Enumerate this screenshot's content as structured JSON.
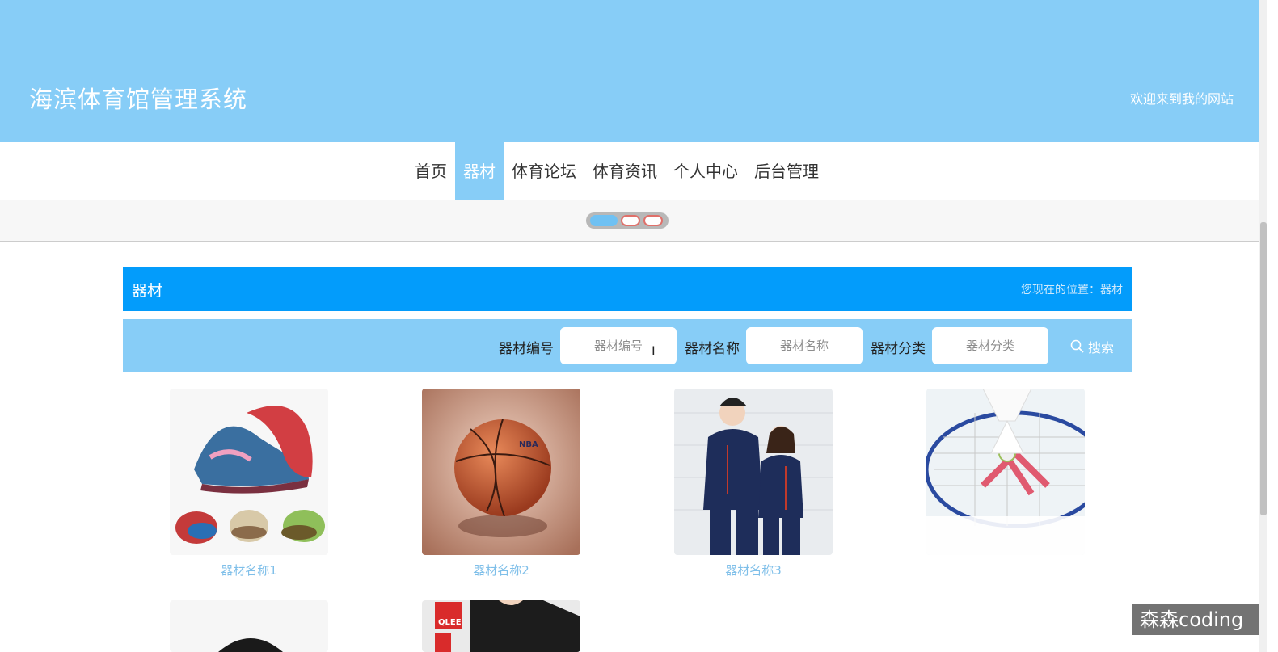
{
  "header": {
    "title": "海滨体育馆管理系统",
    "welcome": "欢迎来到我的网站"
  },
  "nav": {
    "items": [
      {
        "label": "首页",
        "active": false
      },
      {
        "label": "器材",
        "active": true
      },
      {
        "label": "体育论坛",
        "active": false
      },
      {
        "label": "体育资讯",
        "active": false
      },
      {
        "label": "个人中心",
        "active": false
      },
      {
        "label": "后台管理",
        "active": false
      }
    ]
  },
  "section": {
    "title": "器材",
    "breadcrumb": "您现在的位置：器材"
  },
  "search": {
    "fields": [
      {
        "label": "器材编号",
        "placeholder": "器材编号"
      },
      {
        "label": "器材名称",
        "placeholder": "器材名称"
      },
      {
        "label": "器材分类",
        "placeholder": "器材分类"
      }
    ],
    "button": "搜索",
    "icon": "search-icon"
  },
  "products": [
    {
      "name": "器材名称1",
      "image": "sneakers-image"
    },
    {
      "name": "器材名称2",
      "image": "basketball-image"
    },
    {
      "name": "器材名称3",
      "image": "tracksuit-image"
    },
    {
      "name": "",
      "image": "badminton-image"
    },
    {
      "name": "",
      "image": "cap-image"
    },
    {
      "name": "",
      "image": "tshirt-image"
    }
  ],
  "watermark": "森森coding",
  "colors": {
    "header": "#87cdf7",
    "accent": "#039cfb",
    "nav_active": "#87cdf7"
  }
}
